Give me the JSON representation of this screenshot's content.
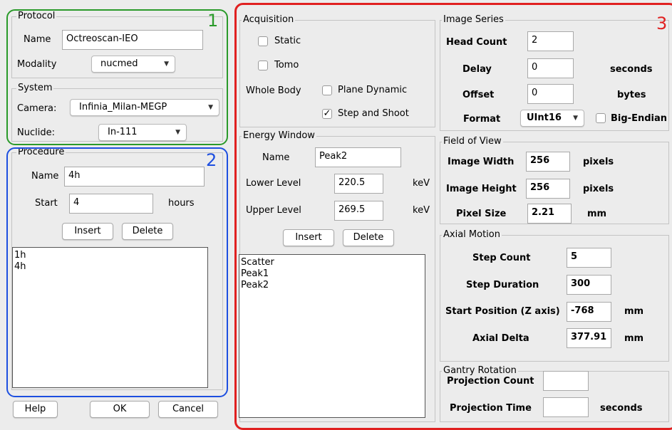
{
  "annotations": {
    "n1": "1",
    "n2": "2",
    "n3": "3"
  },
  "colors": {
    "green": "#2a9a2a",
    "blue": "#1d4fe0",
    "red": "#e02020"
  },
  "protocol": {
    "legend": "Protocol",
    "name_label": "Name",
    "name_value": "Octreoscan-IEO",
    "modality_label": "Modality",
    "modality_value": "nucmed"
  },
  "system": {
    "legend": "System",
    "camera_label": "Camera:",
    "camera_value": "Infinia_Milan-MEGP",
    "nuclide_label": "Nuclide:",
    "nuclide_value": "In-111"
  },
  "procedure": {
    "legend": "Procedure",
    "name_label": "Name",
    "name_value": "4h",
    "start_label": "Start",
    "start_value": "4",
    "start_unit": "hours",
    "insert": "Insert",
    "delete": "Delete",
    "items": [
      "1h",
      "4h"
    ]
  },
  "footer": {
    "help": "Help",
    "ok": "OK",
    "cancel": "Cancel"
  },
  "acquisition": {
    "legend": "Acquisition",
    "static": "Static",
    "tomo": "Tomo",
    "whole_body": "Whole Body",
    "plane_dynamic": "Plane Dynamic",
    "step_and_shoot": "Step and Shoot",
    "check_mark": "✓"
  },
  "energy": {
    "legend": "Energy Window",
    "name_label": "Name",
    "name_value": "Peak2",
    "lower_label": "Lower Level",
    "lower_value": "220.5",
    "lower_unit": "keV",
    "upper_label": "Upper Level",
    "upper_value": "269.5",
    "upper_unit": "keV",
    "insert": "Insert",
    "delete": "Delete",
    "items": [
      "Scatter",
      "Peak1",
      "Peak2"
    ]
  },
  "image_series": {
    "legend": "Image Series",
    "head_count_label": "Head Count",
    "head_count_value": "2",
    "delay_label": "Delay",
    "delay_value": "0",
    "delay_unit": "seconds",
    "offset_label": "Offset",
    "offset_value": "0",
    "offset_unit": "bytes",
    "format_label": "Format",
    "format_value": "UInt16",
    "big_endian": "Big-Endian"
  },
  "fov": {
    "legend": "Field of View",
    "width_label": "Image Width",
    "width_value": "256",
    "width_unit": "pixels",
    "height_label": "Image Height",
    "height_value": "256",
    "height_unit": "pixels",
    "pixel_label": "Pixel Size",
    "pixel_value": "2.21",
    "pixel_unit": "mm"
  },
  "axial": {
    "legend": "Axial Motion",
    "step_count_label": "Step Count",
    "step_count_value": "5",
    "step_duration_label": "Step Duration",
    "step_duration_value": "300",
    "start_pos_label": "Start Position (Z axis)",
    "start_pos_value": "-768",
    "start_pos_unit": "mm",
    "axial_delta_label": "Axial Delta",
    "axial_delta_value": "377.91",
    "axial_delta_unit": "mm"
  },
  "gantry": {
    "legend": "Gantry Rotation",
    "proj_count_label": "Projection Count",
    "proj_count_value": "",
    "proj_time_label": "Projection Time",
    "proj_time_value": "",
    "proj_time_unit": "seconds"
  }
}
